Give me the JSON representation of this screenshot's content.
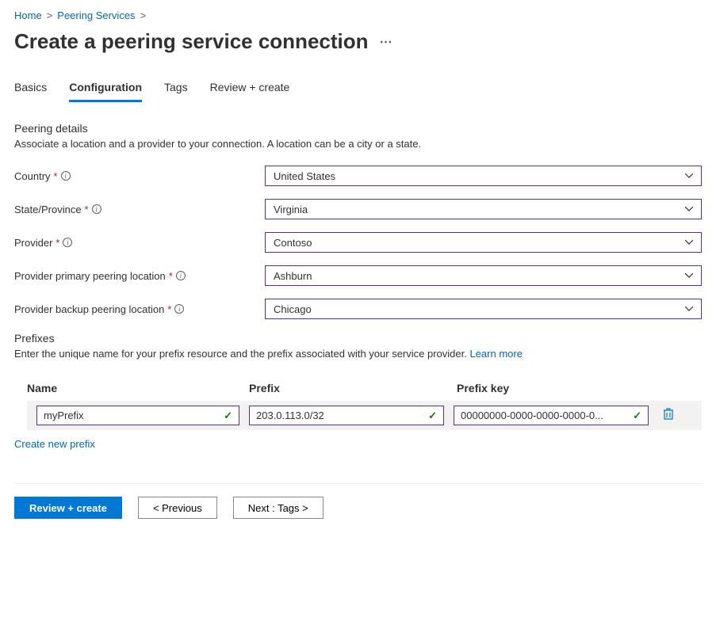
{
  "breadcrumb": {
    "home": "Home",
    "peering_services": "Peering Services"
  },
  "page_title": "Create a peering service connection",
  "tabs": {
    "basics": "Basics",
    "configuration": "Configuration",
    "tags": "Tags",
    "review": "Review + create"
  },
  "peering_details": {
    "title": "Peering details",
    "desc": "Associate a location and a provider to your connection. A location can be a city or a state."
  },
  "fields": {
    "country": {
      "label": "Country",
      "value": "United States"
    },
    "state": {
      "label": "State/Province",
      "value": "Virginia"
    },
    "provider": {
      "label": "Provider",
      "value": "Contoso"
    },
    "primary": {
      "label": "Provider primary peering location",
      "value": "Ashburn"
    },
    "backup": {
      "label": "Provider backup peering location",
      "value": "Chicago"
    }
  },
  "prefixes": {
    "title": "Prefixes",
    "desc": "Enter the unique name for your prefix resource and the prefix associated with your service provider. ",
    "learn_more": "Learn more",
    "headers": {
      "name": "Name",
      "prefix": "Prefix",
      "key": "Prefix key"
    },
    "row": {
      "name": "myPrefix",
      "prefix": "203.0.113.0/32",
      "key": "00000000-0000-0000-0000-0..."
    },
    "create_new": "Create new prefix"
  },
  "footer": {
    "review": "Review + create",
    "previous": "< Previous",
    "next": "Next : Tags >"
  }
}
